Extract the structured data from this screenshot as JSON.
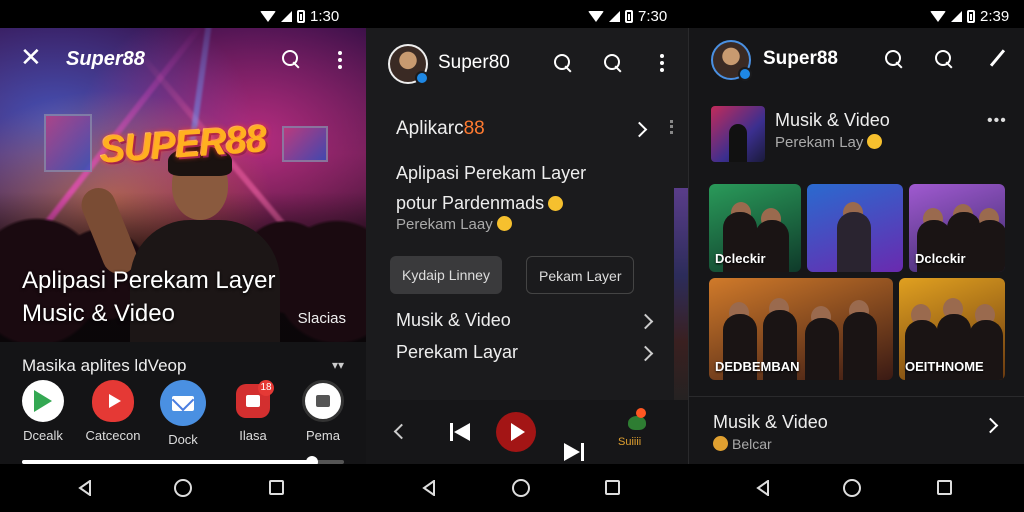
{
  "status_bars": [
    {
      "time": "1:30"
    },
    {
      "time": "7:30"
    },
    {
      "time": "2:39"
    }
  ],
  "panel1": {
    "brand": "Super88",
    "hero_logo": "SUPER88",
    "hero_title_line1": "Aplipasi Perekam Layer",
    "hero_title_line2": "Music & Video",
    "hero_tag": "Slacias",
    "row_title": "Masika aplites ldVeop",
    "apps": [
      {
        "label": "Dcealk",
        "icon": "play-store-icon",
        "color": "#ffffff"
      },
      {
        "label": "Catcecon",
        "icon": "youtube-icon",
        "color": "#e53935"
      },
      {
        "label": "Dock",
        "icon": "mail-icon",
        "color": "#4a90e2"
      },
      {
        "label": "Ilasa",
        "icon": "media-icon",
        "color": "#d32f2f",
        "badge": "18"
      },
      {
        "label": "Pema",
        "icon": "lock-icon",
        "color": "#ffffff"
      }
    ],
    "progress_fraction": 0.9
  },
  "panel2": {
    "brand": "Super80",
    "app_label_prefix": "Aplikarc",
    "app_label_suffix": "88",
    "desc_line1": "Aplipasi Perekam Layer",
    "desc_line2": "potur Pardenmads",
    "sub": "Perekam Laay",
    "chip_active": "Kydaip Linney",
    "chip_inactive": "Pekam Layer",
    "link1": "Musik & Video",
    "link2": "Perekam Layar",
    "player_label": "Suiiii"
  },
  "panel3": {
    "brand": "Super88",
    "header_title": "Musik & Video",
    "header_sub": "Perekam Lay",
    "tiles": [
      {
        "label": "Dcleckir"
      },
      {
        "label": ""
      },
      {
        "label": "Dclcckir"
      },
      {
        "label": "DEDBEMBAN"
      },
      {
        "label": "OEITHNOME"
      }
    ],
    "list_title": "Musik & Video",
    "list_sub": "Belcar"
  }
}
